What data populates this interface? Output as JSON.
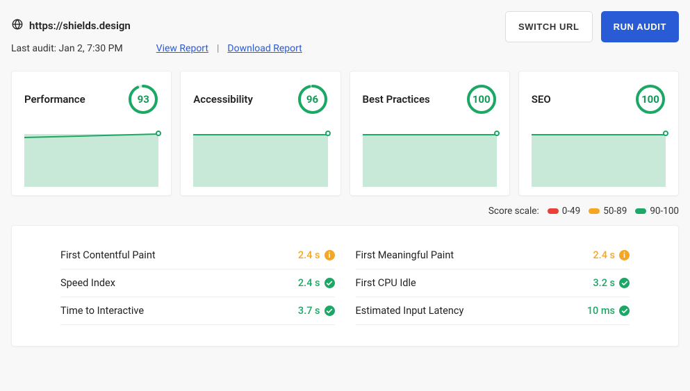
{
  "header": {
    "url": "https://shields.design",
    "last_audit_label": "Last audit: Jan 2, 7:30 PM",
    "view_report_label": "View Report",
    "download_report_label": "Download Report",
    "switch_url_label": "SWITCH URL",
    "run_audit_label": "RUN AUDIT"
  },
  "cards": {
    "performance": {
      "title": "Performance",
      "score": 93
    },
    "accessibility": {
      "title": "Accessibility",
      "score": 96
    },
    "best_practices": {
      "title": "Best Practices",
      "score": 100
    },
    "seo": {
      "title": "SEO",
      "score": 100
    }
  },
  "legend": {
    "label": "Score scale:",
    "low": "0-49",
    "mid": "50-89",
    "high": "90-100"
  },
  "metrics": {
    "left": [
      {
        "label": "First Contentful Paint",
        "value": "2.4 s",
        "status": "warn"
      },
      {
        "label": "Speed Index",
        "value": "2.4 s",
        "status": "pass"
      },
      {
        "label": "Time to Interactive",
        "value": "3.7 s",
        "status": "pass"
      }
    ],
    "right": [
      {
        "label": "First Meaningful Paint",
        "value": "2.4 s",
        "status": "warn"
      },
      {
        "label": "First CPU Idle",
        "value": "3.2 s",
        "status": "pass"
      },
      {
        "label": "Estimated Input Latency",
        "value": "10 ms",
        "status": "pass"
      }
    ]
  },
  "colors": {
    "accent_green": "#1ba764",
    "accent_orange": "#f5a623",
    "accent_red": "#e9403a",
    "primary": "#2a5bd7"
  }
}
